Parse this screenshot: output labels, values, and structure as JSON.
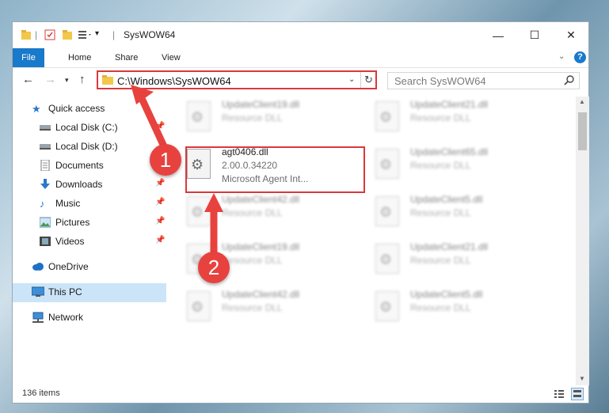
{
  "window": {
    "title": "SysWOW64",
    "controls": {
      "minimize": "—",
      "maximize": "☐",
      "close": "✕"
    }
  },
  "ribbon": {
    "tabs": [
      {
        "label": "File"
      },
      {
        "label": "Home"
      },
      {
        "label": "Share"
      },
      {
        "label": "View"
      }
    ],
    "help": "?"
  },
  "address": {
    "path": "C:\\Windows\\SysWOW64",
    "search_placeholder": "Search SysWOW64"
  },
  "sidebar": {
    "items": [
      {
        "label": "Quick access",
        "icon": "star-icon"
      },
      {
        "label": "Local Disk (C:)",
        "icon": "drive-icon",
        "pinned": true
      },
      {
        "label": "Local Disk (D:)",
        "icon": "drive-icon"
      },
      {
        "label": "Documents",
        "icon": "documents-icon",
        "pinned": true
      },
      {
        "label": "Downloads",
        "icon": "download-icon",
        "pinned": true
      },
      {
        "label": "Music",
        "icon": "music-icon",
        "pinned": true
      },
      {
        "label": "Pictures",
        "icon": "pictures-icon",
        "pinned": true
      },
      {
        "label": "Videos",
        "icon": "videos-icon",
        "pinned": true
      },
      {
        "label": "OneDrive",
        "icon": "cloud-icon"
      },
      {
        "label": "This PC",
        "icon": "computer-icon",
        "selected": true
      },
      {
        "label": "Network",
        "icon": "network-icon"
      }
    ]
  },
  "files": [
    {
      "name": "UpdateClient19.dll",
      "type": "Resource DLL"
    },
    {
      "name": "UpdateClient21.dll",
      "type": "Resource DLL"
    },
    {
      "name": "agt0406.dll",
      "version": "2.00.0.34220",
      "description": "Microsoft Agent Int..."
    },
    {
      "name": "UpdateClient65.dll",
      "type": "Resource DLL"
    },
    {
      "name": "UpdateClient42.dll",
      "type": "Resource DLL"
    },
    {
      "name": "UpdateClient5.dll",
      "type": "Resource DLL"
    },
    {
      "name": "UpdateClient19.dll",
      "type": "Resource DLL"
    },
    {
      "name": "UpdateClient21.dll",
      "type": "Resource DLL"
    },
    {
      "name": "UpdateClient42.dll",
      "type": "Resource DLL"
    },
    {
      "name": "UpdateClient5.dll",
      "type": "Resource DLL"
    }
  ],
  "status": {
    "count": "136 items"
  },
  "callouts": [
    {
      "label": "1"
    },
    {
      "label": "2"
    }
  ],
  "colors": {
    "accent": "#1979ca",
    "highlight": "#d9393b",
    "badge": "#e8423f",
    "selection": "#cce4f7"
  }
}
